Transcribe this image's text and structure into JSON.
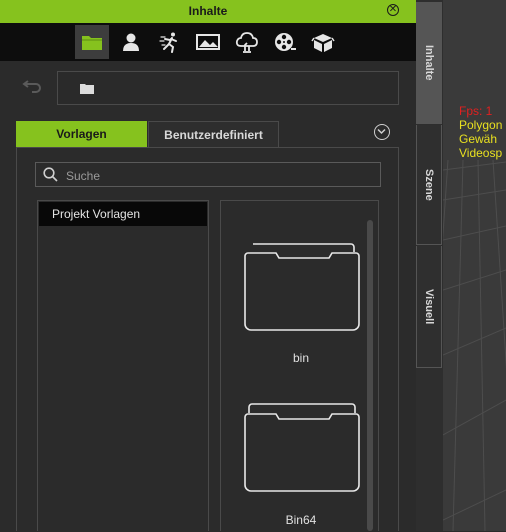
{
  "panel": {
    "title": "Inhalte",
    "close_symbol": "✕"
  },
  "colors": {
    "accent": "#86c21e",
    "titlebar_text": "#1a1a1a",
    "panel_bg": "#2b2b2b",
    "stat_red": "#e02020",
    "stat_yellow": "#e8e020"
  },
  "toolbar": {
    "icons": [
      {
        "name": "folder-icon",
        "active": true
      },
      {
        "name": "avatar-icon",
        "active": false
      },
      {
        "name": "motion-icon",
        "active": false
      },
      {
        "name": "stage-icon",
        "active": false
      },
      {
        "name": "cloud-tree-icon",
        "active": false
      },
      {
        "name": "film-reel-icon",
        "active": false
      },
      {
        "name": "box-icon",
        "active": false
      }
    ]
  },
  "path": {
    "back_icon": "back-arrow-icon",
    "folder_icon": "folder-icon"
  },
  "tabs": {
    "vorlagen": "Vorlagen",
    "benutzerdefiniert": "Benutzerdefiniert"
  },
  "search": {
    "placeholder": "Suche"
  },
  "tree": {
    "items": [
      "Projekt Vorlagen"
    ]
  },
  "files": {
    "items": [
      {
        "label": "bin",
        "icon": "folder-icon"
      },
      {
        "label": "Bin64",
        "icon": "folder-stack-icon"
      }
    ]
  },
  "side_tabs": [
    "Inhalte",
    "Szene",
    "Visuell"
  ],
  "viewport_stats": [
    "Fps: 1",
    "Polygon",
    "Gewäh",
    "Videosp"
  ]
}
